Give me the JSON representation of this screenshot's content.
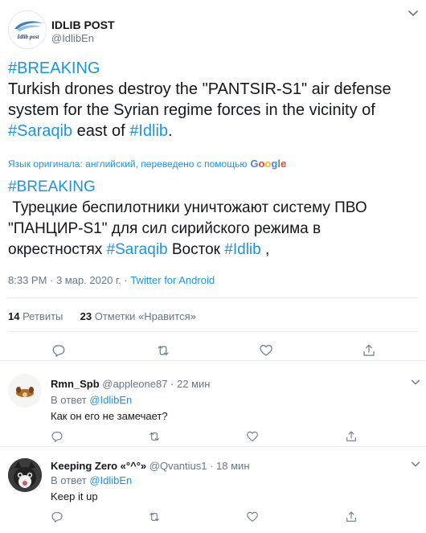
{
  "tweet": {
    "author_name": "IDLIB POST",
    "author_handle": "@IdlibEn",
    "logo_text": "Idlib post",
    "original": {
      "line1": "#BREAKING",
      "line2": "Turkish drones destroy the \"PANTSIR-S1\" air defense",
      "line3": "system for the Syrian regime forces in the vicinity of",
      "line4_tag1": "#Saraqib",
      "line4_mid": " east of ",
      "line4_tag2": "#Idlib",
      "line4_end": "."
    },
    "translation_note": "Язык оригинала: английский, переведено с помощью",
    "google_letters": [
      "G",
      "o",
      "o",
      "g",
      "l",
      "e"
    ],
    "translated": {
      "line1": "#BREAKING",
      "line2": " Турецкие беспилотники уничтожают систему ПВО",
      "line3": "\"ПАНЦИР-S1\" для сил сирийского режима в",
      "line4_start": "окрестностях ",
      "line4_tag1": "#Saraqib",
      "line4_mid": " Восток ",
      "line4_tag2": "#Idlib",
      "line4_end": " ,"
    },
    "time": "8:33 PM · 3 мар. 2020 г.",
    "separator": " · ",
    "source": "Twitter for Android",
    "retweets_count": "14",
    "retweets_label": " Ретвиты",
    "likes_count": "23",
    "likes_label": " Отметки «Нравится»"
  },
  "replies": [
    {
      "name": "Rmn_Spb",
      "handle": "@appleone87",
      "time": " · 22 мин",
      "reply_prefix": "В ответ ",
      "reply_to": "@IdlibEn",
      "text": "Как он его не замечает?"
    },
    {
      "name": "Keeping Zero «°^°»",
      "handle": "@Qvantius1",
      "time": " · 18 мин",
      "reply_prefix": "В ответ ",
      "reply_to": "@IdlibEn",
      "text": "Keep it up"
    }
  ],
  "colors": {
    "link": "#1b95e0",
    "text": "#14171a",
    "secondary": "#657786",
    "border": "#e6ecf0"
  }
}
